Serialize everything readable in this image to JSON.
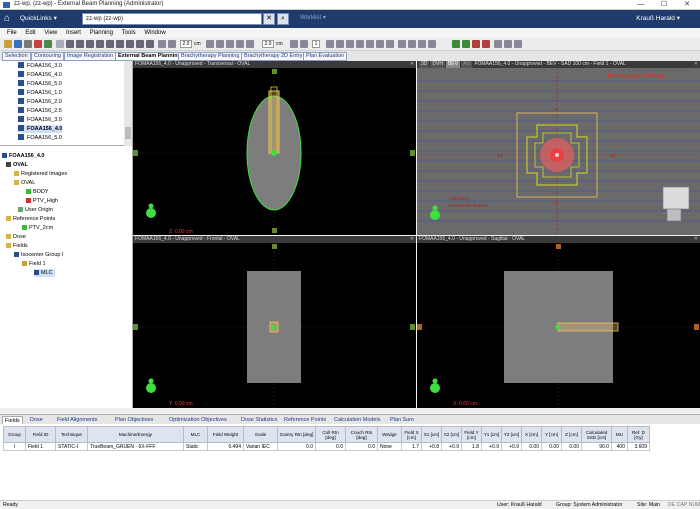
{
  "window": {
    "title": "zz-wp, (zz-wp) - External Beam Planning (Administrator)",
    "minimize": "—",
    "maximize": "☐",
    "close": "✕"
  },
  "quickbar": {
    "quicklinks": "QuickLinks ▾",
    "patient_search": "zz-wp  (zz-wp)",
    "worklist": "Worklist ▾",
    "user": "Krauß Harald ▾"
  },
  "menu": [
    "File",
    "Edit",
    "View",
    "Insert",
    "Planning",
    "Tools",
    "Window"
  ],
  "toolbar": {
    "slice1": "2.0",
    "slice1_unit": "cm",
    "slice2": "2.0",
    "slice2_unit": "cm",
    "slice3": "1"
  },
  "workspace_tabs": [
    {
      "label": "Selection",
      "active": false
    },
    {
      "label": "Contouring",
      "active": false
    },
    {
      "label": "Image Registration",
      "active": false
    },
    {
      "label": "External Beam Planning",
      "active": true
    },
    {
      "label": "Brachytherapy Planning",
      "active": false
    },
    {
      "label": "Brachytherapy 2D Entry",
      "active": false
    },
    {
      "label": "Plan Evaluation",
      "active": false
    }
  ],
  "plan_list": [
    "FOAA156_3.0",
    "FOAA156_4.0",
    "FOAA156_5.0",
    "FOAA156_1.0",
    "FOAA156_2.0",
    "FOAA156_2.5",
    "FOAA156_3.0",
    "FOAA156_4.0",
    "FOAA156_5.0"
  ],
  "plan_list_selected": 7,
  "tree": {
    "plan": "FOAA156_4.0",
    "image": "OVAL",
    "registered_images": "Registered Images",
    "structure_set": "OVAL",
    "body": "BODY",
    "ptv": "PTV_High",
    "user_origin": "User Origin",
    "ref_points": "Reference Points",
    "ptv_ref": "PTV_2cm",
    "dose": "Dose",
    "fields": "Fields",
    "isocenter": "Isocenter Group I",
    "field1": "Field 1",
    "mlc": "MLC"
  },
  "viewports": {
    "transversal": {
      "header": "FOMAA156_4.0 - Unapproved - Transversal - OVAL",
      "coord": "Z: 0.00 cm"
    },
    "bev": {
      "tabs": [
        "3D",
        "DVH",
        "BEV",
        "Arc"
      ],
      "header": "FOMAA156_4.0 - Unapproved - BEV - SAD 100 cm - Field 1 - OVAL",
      "warning": "3D Dose MAX: 11.3% Gy",
      "label1": "Standard",
      "label2": "Head First-Supine",
      "leaf_labels": [
        "X1",
        "X2",
        "Y1",
        "Y2"
      ]
    },
    "frontal": {
      "header": "FOMAA156_4.0 - Unapproved - Frontal - OVAL",
      "coord": "Y: 0.00 cm"
    },
    "sagittal": {
      "header": "FOMAA156_4.0 - Unapproved - Sagittal - OVAL",
      "coord": "X: 0.00 cm"
    }
  },
  "bottom_tabs": [
    {
      "label": "Fields",
      "active": true
    },
    {
      "label": "Dose",
      "active": false
    },
    {
      "label": "Field Alignments",
      "active": false
    },
    {
      "label": "Plan Objectives",
      "active": false
    },
    {
      "label": "Optimization Objectives",
      "active": false
    },
    {
      "label": "Dose Statistics",
      "active": false
    },
    {
      "label": "Reference Points",
      "active": false
    },
    {
      "label": "Calculation Models",
      "active": false
    },
    {
      "label": "Plan Sum",
      "active": false
    }
  ],
  "field_table": {
    "headers": [
      "Group",
      "Field ID",
      "Technique",
      "Machine/Energy",
      "MLC",
      "Field Weight",
      "Scale",
      "Gantry Rtn [deg]",
      "Coll Rtn [deg]",
      "Couch Rtn [deg]",
      "Wedge",
      "Field X [cm]",
      "X1 [cm]",
      "X2 [cm]",
      "Field Y [cm]",
      "Y1 [cm]",
      "Y2 [cm]",
      "X [cm]",
      "Y [cm]",
      "Z [cm]",
      "Calculated SSD [cm]",
      "MU",
      "Ref. D [Gy]"
    ],
    "rows": [
      [
        "I",
        "Field 1",
        "STATIC-I",
        "TrueBeam_GRUEN - 6X-FFF",
        "Static",
        "0.494",
        "Varian IEC",
        "0.0",
        "0.0",
        "0.0",
        "None",
        "1.7",
        "+0.8",
        "+0.9",
        "1.8",
        "+0.9",
        "+0.9",
        "0.00",
        "0.00",
        "0.00",
        "90.0",
        "400",
        "3.609"
      ]
    ]
  },
  "status": {
    "left": "Ready",
    "user": "User: Krauß Harald",
    "group": "Group: System Administrator",
    "site": "Site: Main",
    "lang": "DE  CAP  NUM  SCRL"
  }
}
